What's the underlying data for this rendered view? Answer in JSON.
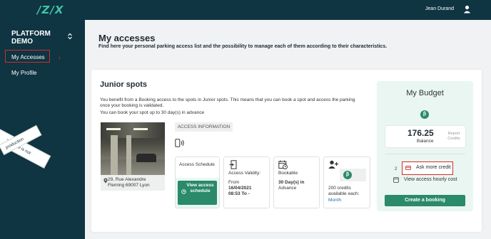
{
  "header": {
    "logo": "/Z/X",
    "user_name": "Jean Durand"
  },
  "sidebar": {
    "platform": "PLATFORM DEMO",
    "items": [
      {
        "label": "My Accesses",
        "marker": "1"
      },
      {
        "label": "My Profile"
      }
    ],
    "ribbon_text": "This site is not",
    "ribbon_text_2": "production"
  },
  "main": {
    "title": "My accesses",
    "subtitle": "Find here your personal parking access list and the possibility to manage each of them according to their characteristics."
  },
  "access": {
    "title": "Junior spots",
    "desc_line1": "You benefit from a Booking access to the spots in Junior spots. This means that you can book a spot and access the parking",
    "desc_line2": "once your booking is validated.",
    "desc_line3": "You can book your spot up to 30 day(s) in advance",
    "address": "29, Rue Alexandre Fleming 69007 Lyon",
    "access_info_label": "ACCESS INFORMATION",
    "schedule_label": "Access Schedule",
    "schedule_button": "View access schedule",
    "validity_label": "Access Validity:",
    "validity_from": "From",
    "validity_date": "16/04/2021",
    "validity_time": "08:53 To -",
    "bookable_label": "Bookable",
    "bookable_days": "30 Day(s) in",
    "bookable_adv": "Advance",
    "credit_coin": "β",
    "credit_line1": "200 credits",
    "credit_line2": "available each:",
    "credit_period": "Month"
  },
  "budget": {
    "title": "My Budget",
    "coin": "β",
    "balance_value": "176.25",
    "balance_label": "Balance",
    "report_credits": "Report Credits",
    "ask_more_credit": "Ask more credit",
    "ask_marker": "2",
    "hourly_cost": "View access hourly cost",
    "create_booking": "Create a booking"
  },
  "colors": {
    "nav_bg": "#0f3442",
    "brand_teal": "#3fc3a4",
    "button_green": "#2a8a6a",
    "highlight_red": "#d52b2b"
  }
}
